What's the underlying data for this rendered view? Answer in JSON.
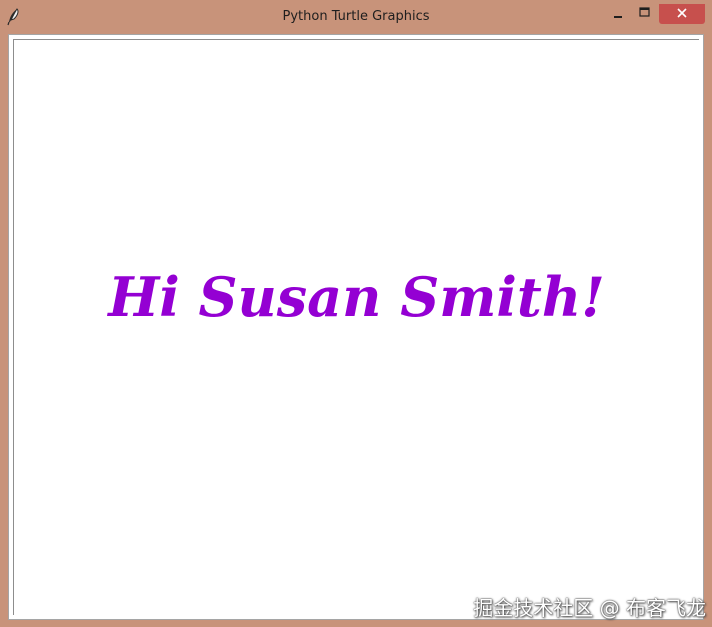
{
  "window": {
    "title": "Python Turtle Graphics",
    "frame_color": "#c8937a",
    "close_color": "#c7504d"
  },
  "icons": {
    "app": "feather-icon",
    "minimize": "minimize-icon",
    "maximize": "maximize-icon",
    "close": "close-icon"
  },
  "canvas": {
    "text": "Hi Susan Smith!",
    "text_color": "#9400d3"
  },
  "watermark": {
    "text": "掘金技术社区 @ 布客飞龙"
  }
}
